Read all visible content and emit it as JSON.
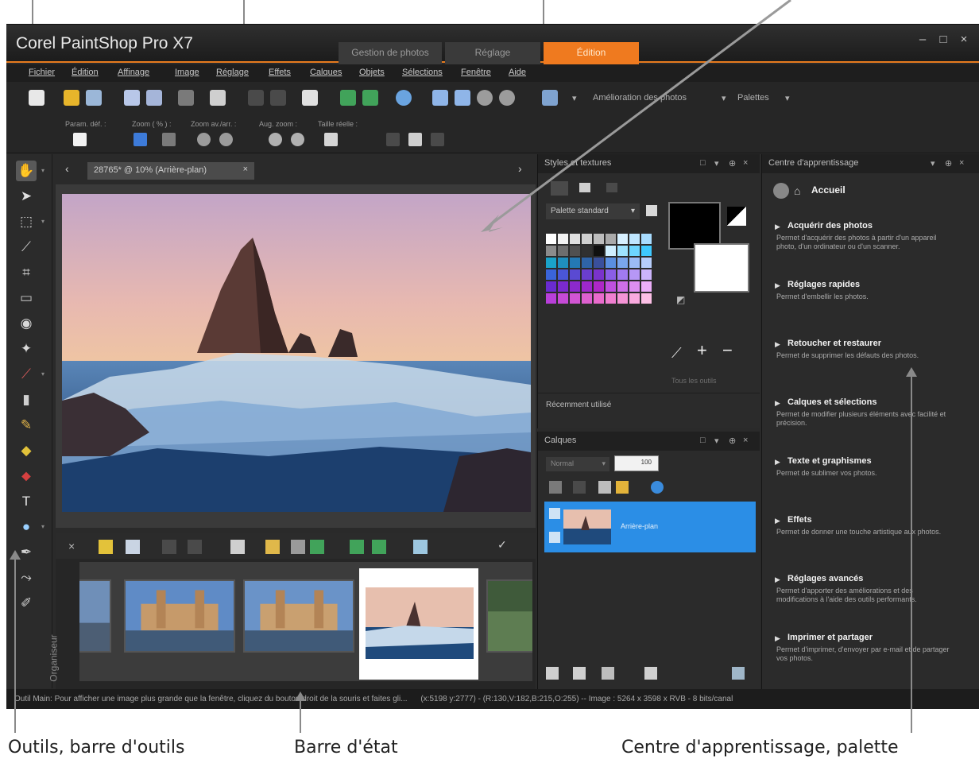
{
  "app": {
    "title": "Corel PaintShop Pro X7",
    "tabs": [
      "Gestion de photos",
      "Réglage",
      "Édition"
    ],
    "active_tab": "Édition",
    "window_controls": [
      "–",
      "□",
      "×"
    ]
  },
  "menu": [
    "Fichier",
    "Édition",
    "Affinage",
    "Image",
    "Réglage",
    "Effets",
    "Calques",
    "Objets",
    "Sélections",
    "Fenêtre",
    "Aide"
  ],
  "toolbar": {
    "enhance_label": "Amélioration des photos",
    "palettes_label": "Palettes"
  },
  "options": {
    "labels": [
      "Param. déf. :",
      "Zoom ( % ) :",
      "Zoom av./arr. :",
      "Aug. zoom :",
      "Taille réelle :"
    ]
  },
  "document": {
    "tab_label": "28765* @ 10% (Arrière-plan)"
  },
  "styles_panel": {
    "title": "Styles et textures",
    "palette_select": "Palette standard",
    "all_tools": "Tous les outils",
    "recent": "Récemment utilisé"
  },
  "layers_panel": {
    "title": "Calques",
    "blend_mode": "Normal",
    "opacity": "100",
    "layer_name": "Arrière-plan"
  },
  "learning": {
    "title": "Centre d'apprentissage",
    "home": "Accueil",
    "sections": [
      {
        "title": "Acquérir des photos",
        "desc": "Permet d'acquérir des photos à partir d'un appareil photo, d'un ordinateur ou d'un scanner."
      },
      {
        "title": "Réglages rapides",
        "desc": "Permet d'embellir les photos."
      },
      {
        "title": "Retoucher et restaurer",
        "desc": "Permet de supprimer les défauts des photos."
      },
      {
        "title": "Calques et sélections",
        "desc": "Permet de modifier plusieurs éléments avec facilité et précision."
      },
      {
        "title": "Texte et graphismes",
        "desc": "Permet de sublimer vos photos."
      },
      {
        "title": "Effets",
        "desc": "Permet de donner une touche artistique aux photos."
      },
      {
        "title": "Réglages avancés",
        "desc": "Permet d'apporter des améliorations et des modifications à l'aide des outils performants."
      },
      {
        "title": "Imprimer et partager",
        "desc": "Permet d'imprimer, d'envoyer par e-mail et de partager vos photos."
      }
    ]
  },
  "organizer": {
    "label": "Organiseur"
  },
  "status": {
    "hint": "Outil Main: Pour afficher une image plus grande que la fenêtre, cliquez du bouton droit de la souris et faites gli...",
    "coords": "(x:5198 y:2777) - (R:130,V:182,B:215,O:255) -- Image : 5264 x 3598 x RVB - 8 bits/canal"
  },
  "captions": {
    "tools": "Outils, barre d'outils",
    "status": "Barre d'état",
    "learning": "Centre d'apprentissage, palette"
  },
  "colors": {
    "accent": "#ef7a1f",
    "selection": "#2b8ee6"
  }
}
